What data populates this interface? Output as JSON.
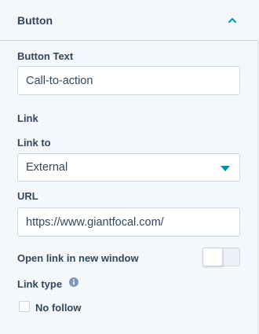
{
  "header": {
    "title": "Button",
    "toggle_icon": "chevron-up-icon"
  },
  "button_text": {
    "label": "Button Text",
    "value": "Call-to-action"
  },
  "link_section": {
    "title": "Link"
  },
  "link_to": {
    "label": "Link to",
    "selected": "External",
    "icon": "caret-down-icon"
  },
  "url": {
    "label": "URL",
    "value": "https://www.giantfocal.com/"
  },
  "new_window": {
    "label": "Open link in new window",
    "enabled": false
  },
  "link_type": {
    "label": "Link type",
    "info_icon": "info-icon",
    "no_follow": {
      "label": "No follow",
      "checked": false
    }
  },
  "colors": {
    "accent": "#0091ae",
    "text": "#33475b",
    "border": "#cbd6e2",
    "background": "#f5f8fa"
  }
}
